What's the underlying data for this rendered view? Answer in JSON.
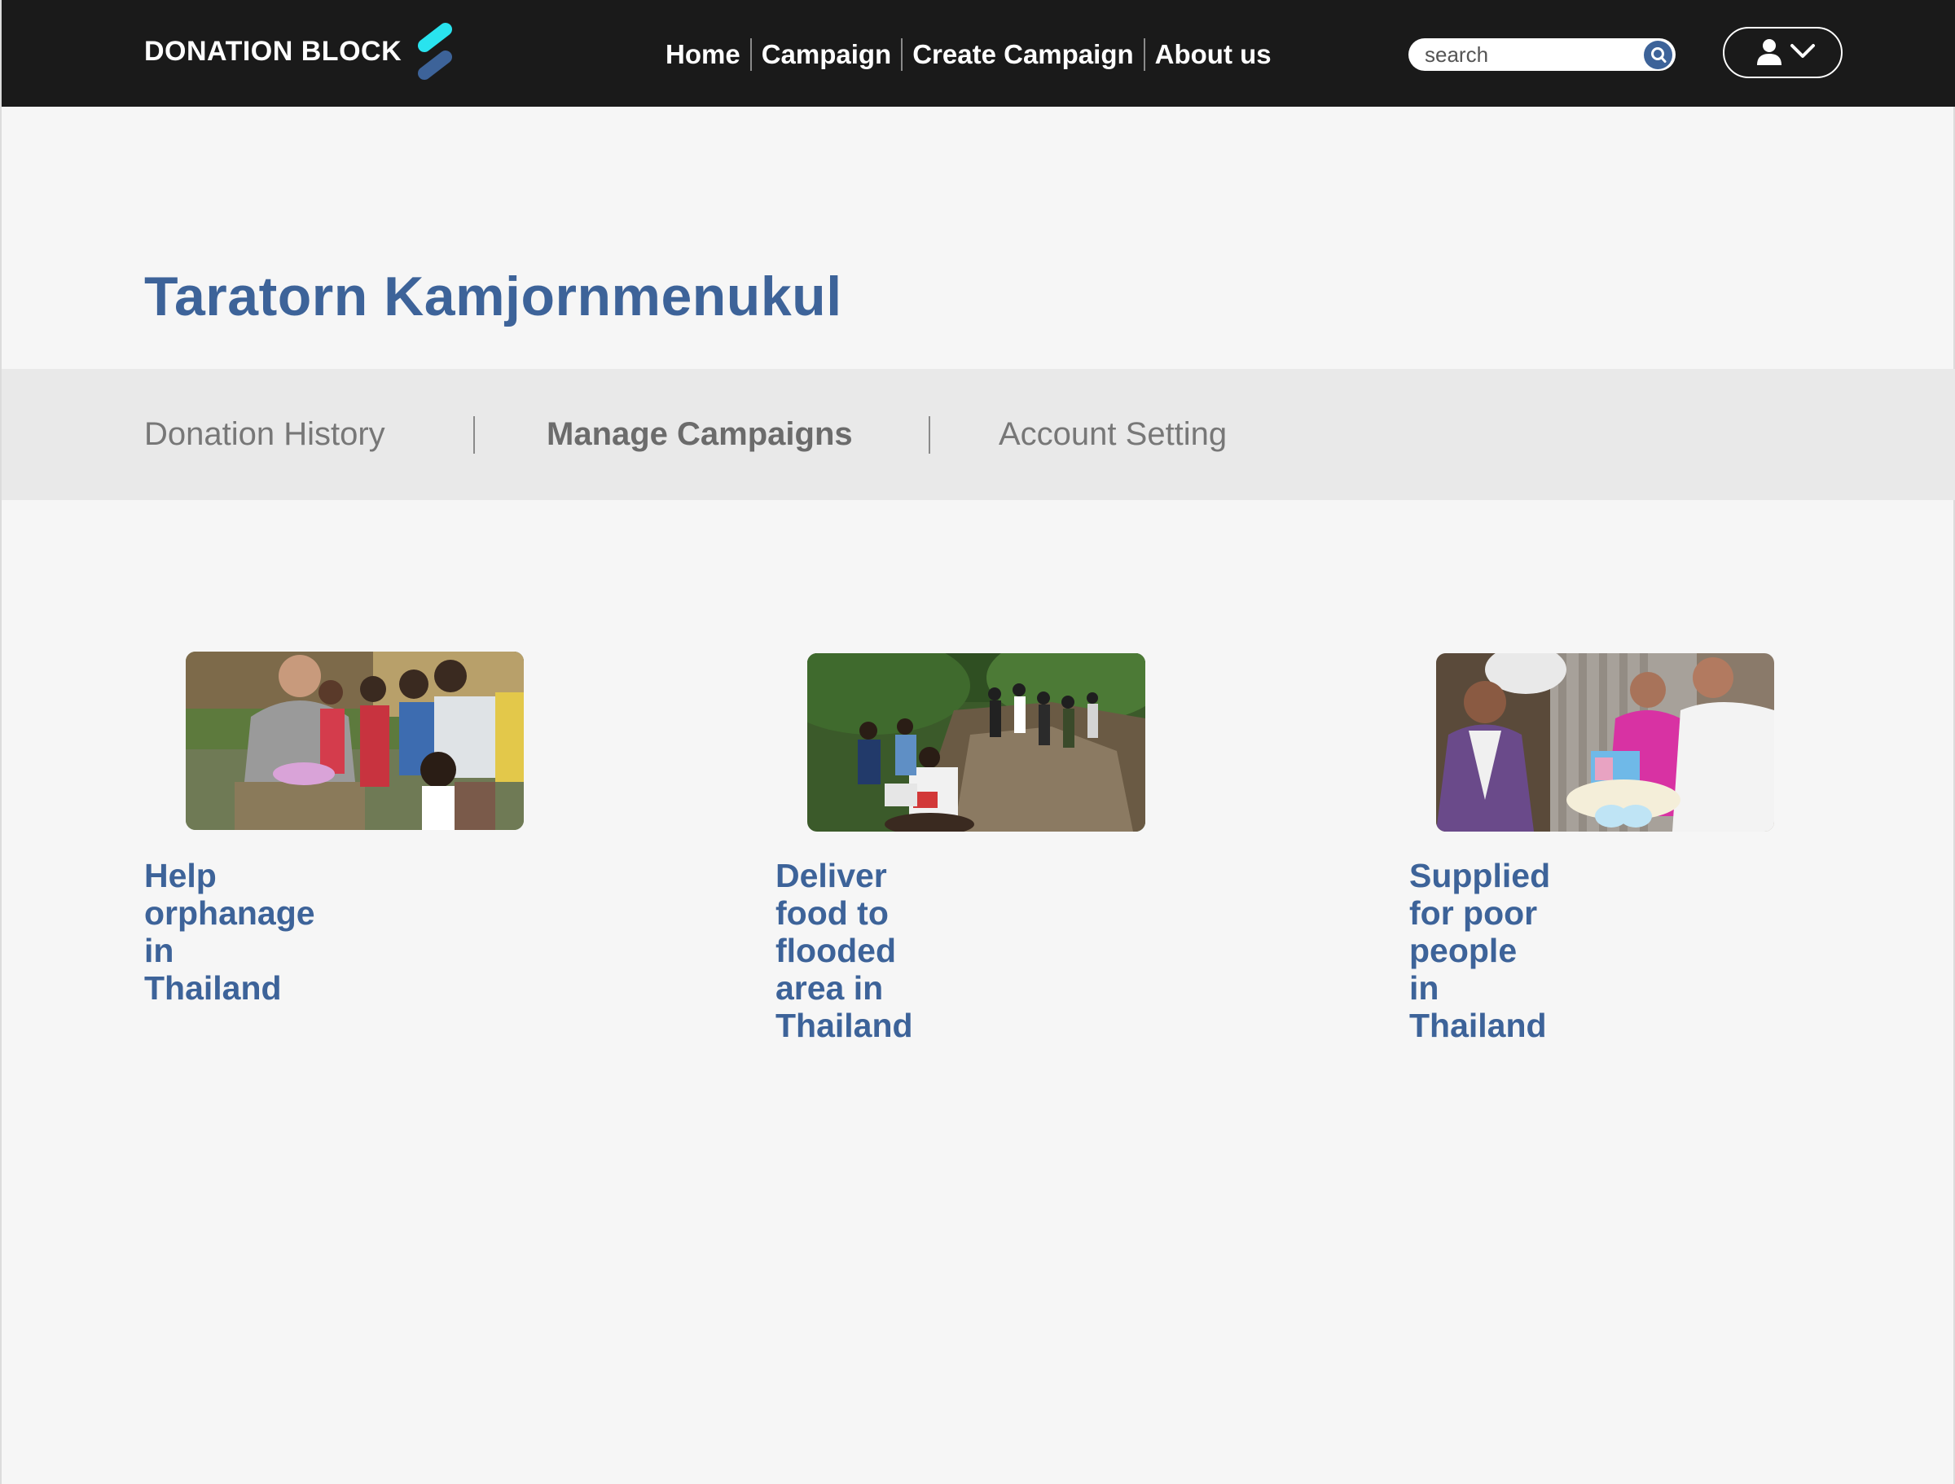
{
  "header": {
    "brand": "DONATION BLOCK",
    "nav": [
      {
        "label": "Home"
      },
      {
        "label": "Campaign"
      },
      {
        "label": "Create Campaign"
      },
      {
        "label": "About us"
      }
    ],
    "search": {
      "placeholder": "search"
    }
  },
  "profile": {
    "name": "Taratorn Kamjornmenukul"
  },
  "tabs": [
    {
      "label": "Donation History",
      "active": false
    },
    {
      "label": "Manage Campaigns",
      "active": true
    },
    {
      "label": "Account Setting",
      "active": false
    }
  ],
  "campaigns": [
    {
      "title_line1": "Help orphanage in Thailand",
      "title_line2": ""
    },
    {
      "title_line1": "Deliver food to flooded",
      "title_line2": "area in Thailand"
    },
    {
      "title_line1": "Supplied for poor people",
      "title_line2": "in Thailand"
    }
  ],
  "colors": {
    "accent": "#3d6399",
    "topbar": "#1a1a1a",
    "logo_top": "#29e3ee",
    "logo_bottom": "#3d6399",
    "tab_strip": "#e9e9e9",
    "background": "#f6f6f6"
  }
}
